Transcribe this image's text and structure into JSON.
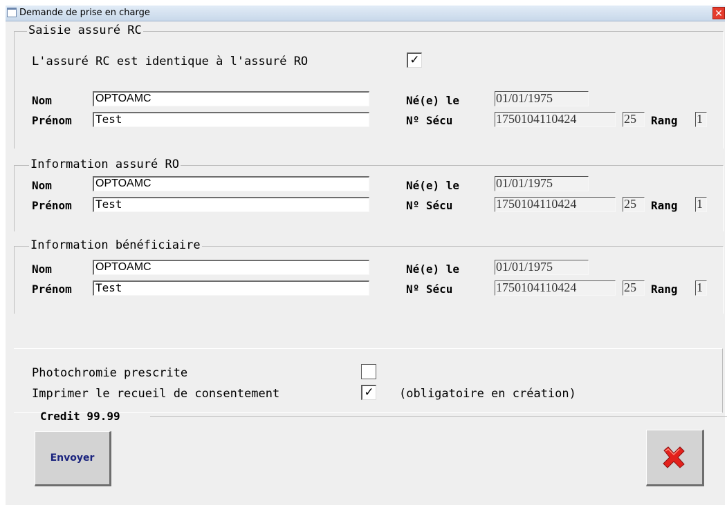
{
  "window": {
    "title": "Demande de prise en charge",
    "close_label": "✕"
  },
  "rc": {
    "legend": "Saisie assuré RC",
    "same_label": "L'assuré RC est identique à l'assuré RO",
    "same_checked": "✓",
    "nom_label": "Nom",
    "nom": "OPTOAMC",
    "prenom_label": "Prénom",
    "prenom": "Test",
    "ne_label": "Né(e) le",
    "ne": "01/01/1975",
    "secu_label": "Nº Sécu",
    "secu": "1750104110424",
    "cle": "25",
    "rang_label": "Rang",
    "rang": "1"
  },
  "ro": {
    "legend": "Information assuré RO",
    "nom_label": "Nom",
    "nom": "OPTOAMC",
    "prenom_label": "Prénom",
    "prenom": "Test",
    "ne_label": "Né(e) le",
    "ne": "01/01/1975",
    "secu_label": "Nº Sécu",
    "secu": "1750104110424",
    "cle": "25",
    "rang_label": "Rang",
    "rang": "1"
  },
  "benef": {
    "legend": "Information bénéficiaire",
    "nom_label": "Nom",
    "nom": "OPTOAMC",
    "prenom_label": "Prénom",
    "prenom": "Test",
    "ne_label": "Né(e) le",
    "ne": "01/01/1975",
    "secu_label": "Nº Sécu",
    "secu": "1750104110424",
    "cle": "25",
    "rang_label": "Rang",
    "rang": "1"
  },
  "options": {
    "photo_label": "Photochromie prescrite",
    "photo_checked": "",
    "consent_label": "Imprimer le recueil de consentement",
    "consent_checked": "✓",
    "consent_note": "(obligatoire en création)",
    "credit": "Credit 99.99"
  },
  "buttons": {
    "send_label": "Envoyer",
    "cancel_icon": "red-x-icon"
  },
  "colors": {
    "send_text": "#1a237e",
    "cancel_red": "#e3211c"
  }
}
